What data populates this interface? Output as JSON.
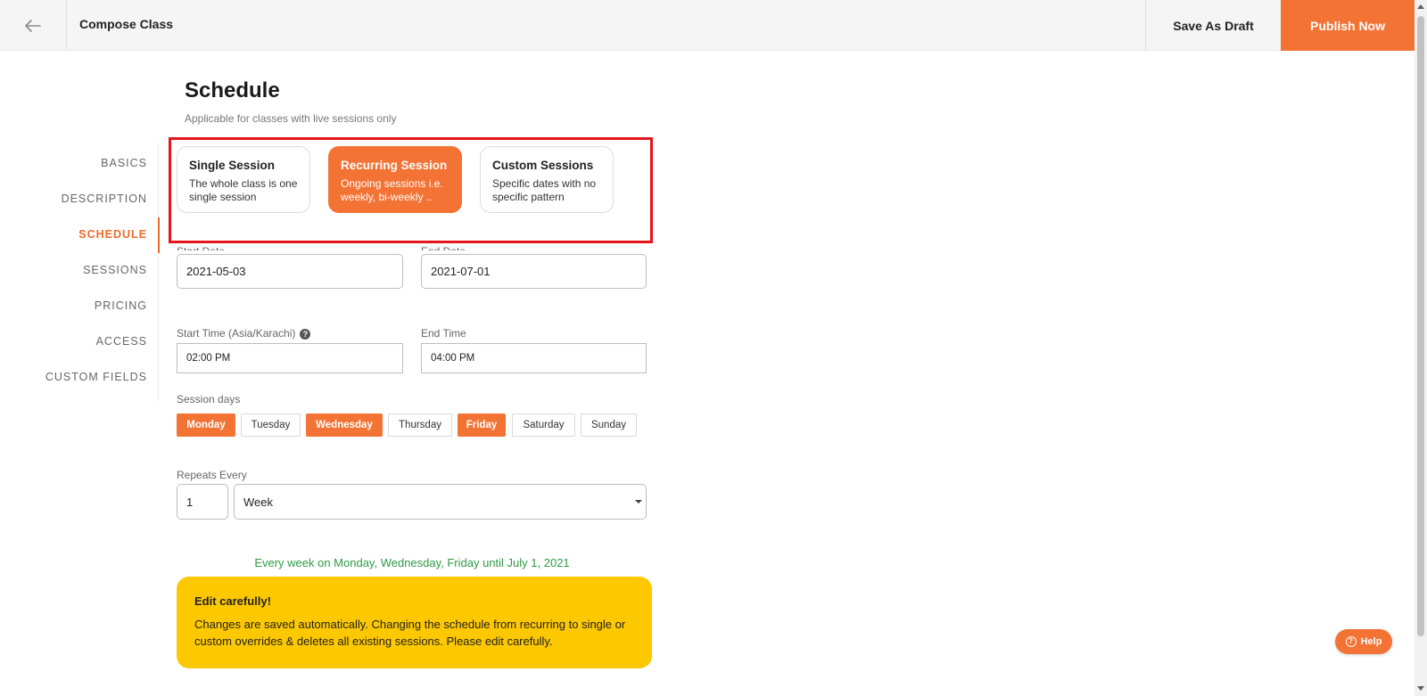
{
  "header": {
    "back_icon": "arrow-left-icon",
    "title": "Compose Class",
    "draft_label": "Save As Draft",
    "publish_label": "Publish Now",
    "accent_color": "#f37335"
  },
  "sidebar": {
    "items": [
      {
        "label": "BASICS"
      },
      {
        "label": "DESCRIPTION"
      },
      {
        "label": "SCHEDULE",
        "active": true
      },
      {
        "label": "SESSIONS"
      },
      {
        "label": "PRICING"
      },
      {
        "label": "ACCESS"
      },
      {
        "label": "CUSTOM FIELDS"
      }
    ]
  },
  "schedule": {
    "title": "Schedule",
    "subtitle": "Applicable for classes with live sessions only",
    "session_types": [
      {
        "title": "Single Session",
        "desc": "The whole class is one single session",
        "selected": false
      },
      {
        "title": "Recurring Session",
        "desc": "Ongoing sessions i.e. weekly, bi-weekly ..",
        "selected": true
      },
      {
        "title": "Custom Sessions",
        "desc": "Specific dates with no specific pattern",
        "selected": false
      }
    ],
    "start_date": {
      "label": "Start Date",
      "value": "2021-05-03"
    },
    "end_date": {
      "label": "End Date",
      "value": "2021-07-01"
    },
    "start_time": {
      "label": "Start Time (Asia/Karachi)",
      "value": "02:00 PM",
      "help_icon": "question-circle-icon"
    },
    "end_time": {
      "label": "End Time",
      "value": "04:00 PM"
    },
    "session_days": {
      "label": "Session days",
      "days": [
        {
          "label": "Monday",
          "on": true
        },
        {
          "label": "Tuesday",
          "on": false
        },
        {
          "label": "Wednesday",
          "on": true
        },
        {
          "label": "Thursday",
          "on": false
        },
        {
          "label": "Friday",
          "on": true
        },
        {
          "label": "Saturday",
          "on": false
        },
        {
          "label": "Sunday",
          "on": false
        }
      ]
    },
    "repeats": {
      "label": "Repeats Every",
      "count": "1",
      "unit": "Week"
    },
    "summary": "Every week on Monday, Wednesday, Friday until July 1, 2021",
    "warning": {
      "title": "Edit carefully!",
      "body": "Changes are saved automatically. Changing the schedule from recurring to single or custom overrides & deletes all existing sessions. Please edit carefully."
    }
  },
  "help_button": {
    "label": "Help",
    "icon": "question-circle-icon"
  }
}
